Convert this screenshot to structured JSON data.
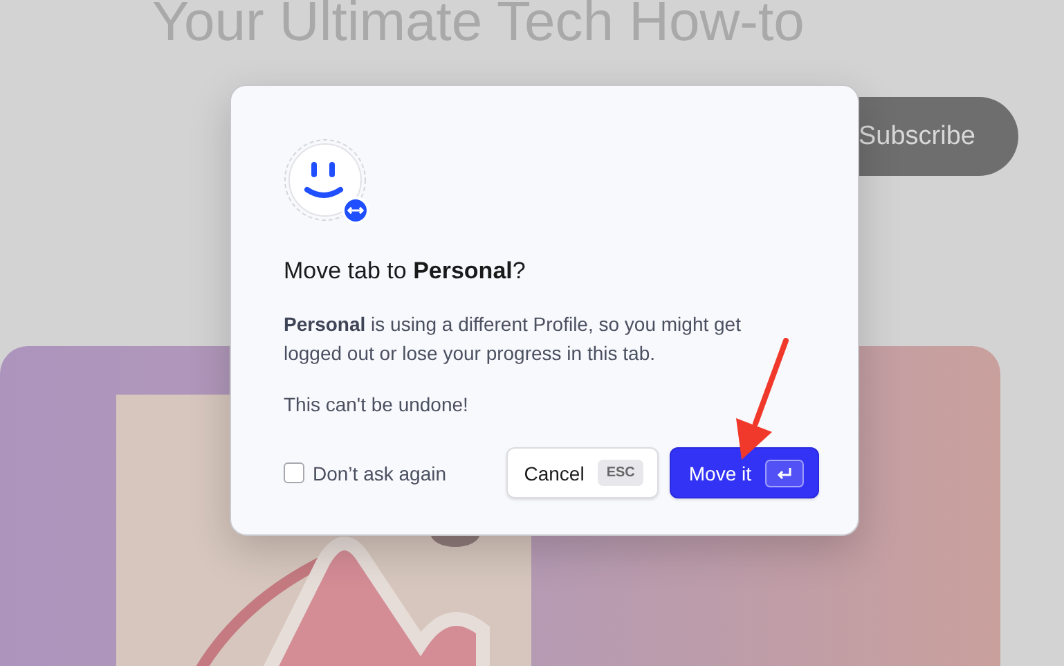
{
  "background_page": {
    "headline": "Your Ultimate Tech How-to",
    "subscribe_button": "Subscribe"
  },
  "dialog": {
    "title": "Move tab to **Personal**?",
    "message": "**Personal** is using a different Profile, so you might get logged out or lose your progress in this tab.",
    "warning": "This can't be undone!",
    "checkbox": {
      "label": "Don’t ask again",
      "checked": false
    },
    "buttons": [
      {
        "kind": "secondary",
        "label": "Cancel",
        "shortcut": "ESC"
      },
      {
        "kind": "primary",
        "label": "Move it"
      }
    ]
  }
}
